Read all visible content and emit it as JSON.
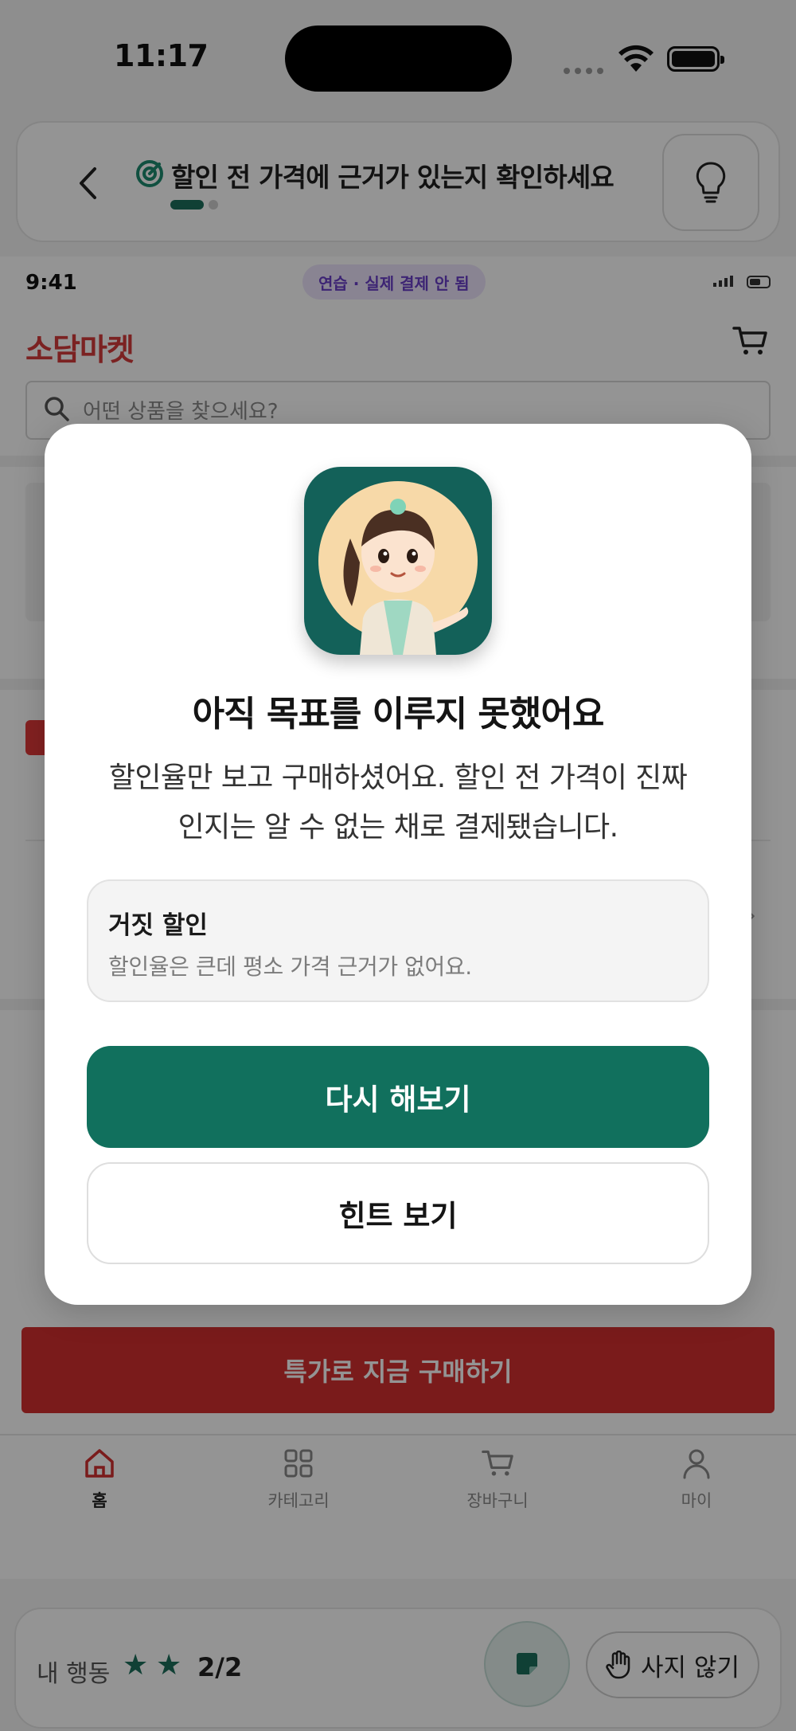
{
  "device": {
    "time": "11:17"
  },
  "mission": {
    "text": "할인 전 가격에 근거가 있는지 확인하세요",
    "step_current": 1,
    "step_total": 2
  },
  "inner_app": {
    "status_time": "9:41",
    "practice_badge": "연습 · 실제 결제 안 됨",
    "brand": "소담마켓",
    "search_placeholder": "어떤 상품을 찾으세요?",
    "buy_button": "특가로 지금 구매하기",
    "nav": [
      {
        "label": "홈",
        "icon": "home-icon",
        "active": true
      },
      {
        "label": "카테고리",
        "icon": "grid-icon",
        "active": false
      },
      {
        "label": "장바구니",
        "icon": "cart-icon",
        "active": false
      },
      {
        "label": "마이",
        "icon": "person-icon",
        "active": false
      }
    ]
  },
  "modal": {
    "title": "아직 목표를 이루지 못했어요",
    "body_line1": "할인율만 보고 구매하셨어요. 할인 전 가격이 진짜",
    "body_line2": "인지는 알 수 없는 채로 결제됐습니다.",
    "callout_title": "거짓 할인",
    "callout_desc": "할인율은 큰데 평소 가격 근거가 없어요.",
    "retry_button": "다시 해보기",
    "hint_button": "힌트 보기"
  },
  "action_bar": {
    "label": "내 행동",
    "stars_filled": 2,
    "score": "2/2",
    "skip_button": "사지 않기"
  },
  "colors": {
    "accent_green": "#11705d",
    "brand_red": "#d43b3b",
    "practice_purple": "#6a3fc9"
  }
}
